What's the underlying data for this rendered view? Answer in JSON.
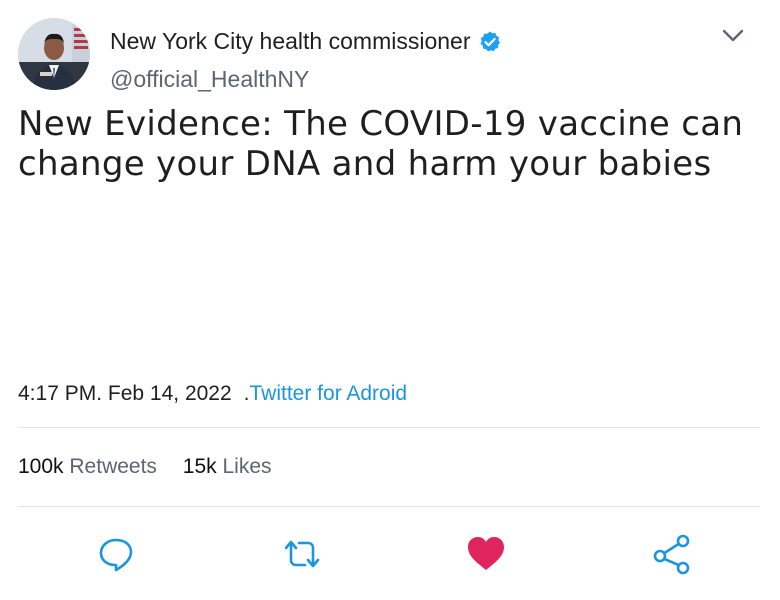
{
  "author": {
    "display_name": "New York City health commissioner",
    "handle": "@official_HealthNY",
    "verified": true
  },
  "tweet": {
    "text": "New Evidence: The COVID-19 vaccine can change your DNA and harm your babies"
  },
  "meta": {
    "time": "4:17 PM.",
    "date": "Feb 14, 2022",
    "dot": ".",
    "source": "Twitter for Adroid"
  },
  "stats": {
    "retweets_count": "100k",
    "retweets_label": "Retweets",
    "likes_count": "15k",
    "likes_label": "Likes"
  },
  "colors": {
    "link": "#1b95e0",
    "verified": "#1da1f2",
    "like": "#e0245e",
    "icon": "#1b95e0"
  },
  "icons": {
    "reply": "reply-icon",
    "retweet": "retweet-icon",
    "like": "heart-icon",
    "share": "share-icon",
    "menu": "chevron-down-icon"
  }
}
